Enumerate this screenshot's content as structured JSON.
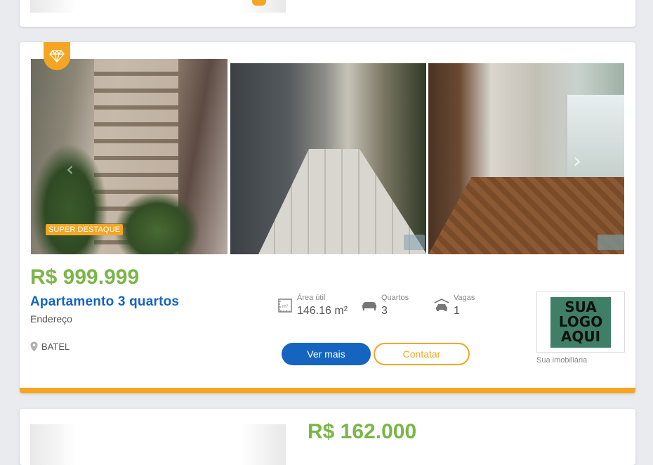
{
  "listing": {
    "badge": "SUPER DESTAQUE",
    "price": "R$ 999.999",
    "title": "Apartamento 3 quartos",
    "address": "Endereço",
    "district": "BATEL",
    "features": {
      "area": {
        "label": "Área útil",
        "value": "146.16 m²",
        "icon": "area-icon"
      },
      "rooms": {
        "label": "Quartos",
        "value": "3",
        "icon": "bed-icon"
      },
      "parking": {
        "label": "Vagas",
        "value": "1",
        "icon": "car-icon"
      }
    },
    "buttons": {
      "more": "Ver mais",
      "contact": "Contatar"
    },
    "agency": {
      "logo_text": [
        "SUA",
        "LOGO",
        "AQUI"
      ],
      "label": "Sua imobiliária"
    }
  },
  "next_listing": {
    "price": "R$ 162.000"
  },
  "colors": {
    "accent": "#f4a623",
    "price": "#7ab648",
    "primary": "#1565c0"
  }
}
